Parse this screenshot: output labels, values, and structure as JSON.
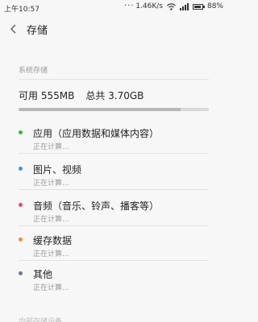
{
  "status_bar": {
    "time": "上午10:57",
    "dots": "···",
    "speed": "1.46K/s",
    "battery": "88%",
    "battery_level": 0.88
  },
  "header": {
    "title": "存储"
  },
  "storage": {
    "section_label": "系统存储",
    "available": "可用 555MB",
    "total": "总共 3.70GB",
    "used_fraction": 0.85
  },
  "categories": [
    {
      "name": "应用（应用数据和媒体内容）",
      "status": "正在计算...",
      "color": "#3cb043"
    },
    {
      "name": "图片、视频",
      "status": "正在计算...",
      "color": "#4a90d9"
    },
    {
      "name": "音频（音乐、铃声、播客等）",
      "status": "正在计算...",
      "color": "#e04a86"
    },
    {
      "name": "缓存数据",
      "status": "正在计算...",
      "color": "#f0902a"
    },
    {
      "name": "其他",
      "status": "正在计算...",
      "color": "#6b7b93"
    }
  ],
  "bottom_label": "内部存储设备"
}
